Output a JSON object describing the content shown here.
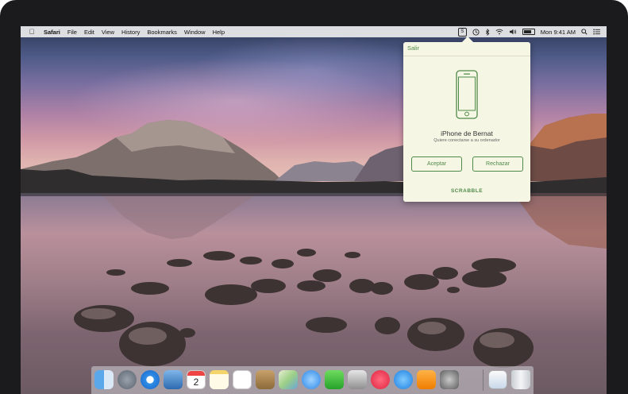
{
  "menubar": {
    "apple": "",
    "items": [
      "Safari",
      "File",
      "Edit",
      "View",
      "History",
      "Bookmarks",
      "Window",
      "Help"
    ],
    "clock": "Mon 9:41 AM",
    "right_icons": [
      "scrabble-menu-icon",
      "time-machine-icon",
      "bluetooth-icon",
      "wifi-icon",
      "volume-icon",
      "battery-icon",
      "search-icon",
      "notification-center-icon"
    ]
  },
  "popover": {
    "quit_label": "Salir",
    "device_name": "iPhone de Bernat",
    "device_subtitle": "Quiere conectarse a su ordenador",
    "accept_label": "Aceptar",
    "reject_label": "Rechazar",
    "brand": "SCRABBLE",
    "accent": "#4f8a48"
  },
  "dock": {
    "calendar_day": "2",
    "apps": [
      "finder",
      "launchpad",
      "safari",
      "mail",
      "calendar",
      "notes",
      "reminders",
      "contacts",
      "maps",
      "messages",
      "facetime",
      "photo-booth",
      "itunes",
      "app-store",
      "ibooks",
      "system-preferences",
      "preview",
      "trash"
    ]
  }
}
